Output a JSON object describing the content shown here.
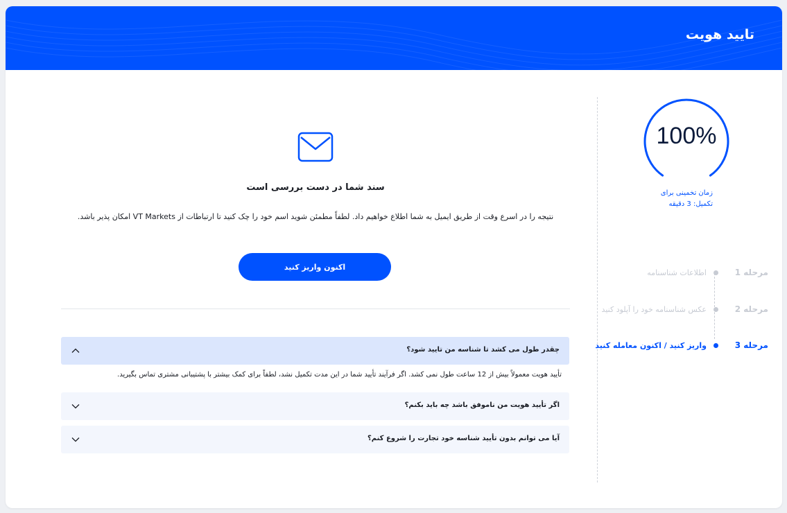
{
  "header": {
    "title": "تایید هویت"
  },
  "progress": {
    "percent_label": "100%",
    "percent_value": 100,
    "estimate_line1": "زمان تخمینی برای",
    "estimate_line2": "تکمیل: 3 دقیقه"
  },
  "steps": [
    {
      "number": "مرحله 1",
      "label": "اطلاعات شناسنامه",
      "state": "done"
    },
    {
      "number": "مرحله 2",
      "label": "عکس شناسنامه خود را آپلود کنید",
      "state": "done"
    },
    {
      "number": "مرحله 3",
      "label": "واریز کنید / اکنون معامله کنید",
      "state": "active"
    }
  ],
  "main": {
    "title": "سند شما در دست بررسی است",
    "description": "نتیجه را در اسرع وقت از طریق ایمیل به شما اطلاع خواهیم داد. لطفاً مطمئن شوید اسم خود را چک کنید تا ارتباطات از VT Markets امکان پذیر باشد.",
    "deposit_button": "اکنون واریز کنید"
  },
  "faq": [
    {
      "question": "چقدر طول می کشد تا شناسه من تایید شود؟",
      "answer": "تأیید هویت معمولاً بیش از 12 ساعت طول نمی کشد. اگر فرآیند تأیید شما در این مدت تکمیل نشد، لطفاً برای کمک بیشتر با پشتیبانی مشتری تماس بگیرید.",
      "open": true
    },
    {
      "question": "اگر تأیید هویت من ناموفق باشد چه باید بکنم؟",
      "open": false
    },
    {
      "question": "آیا می توانم بدون تأیید شناسه خود تجارت را شروع کنم؟",
      "open": false
    }
  ],
  "colors": {
    "brand": "#0052ff",
    "muted": "#c7cbd3",
    "faq_open_bg": "#dbe6fd",
    "faq_bg": "#f3f6fd"
  }
}
